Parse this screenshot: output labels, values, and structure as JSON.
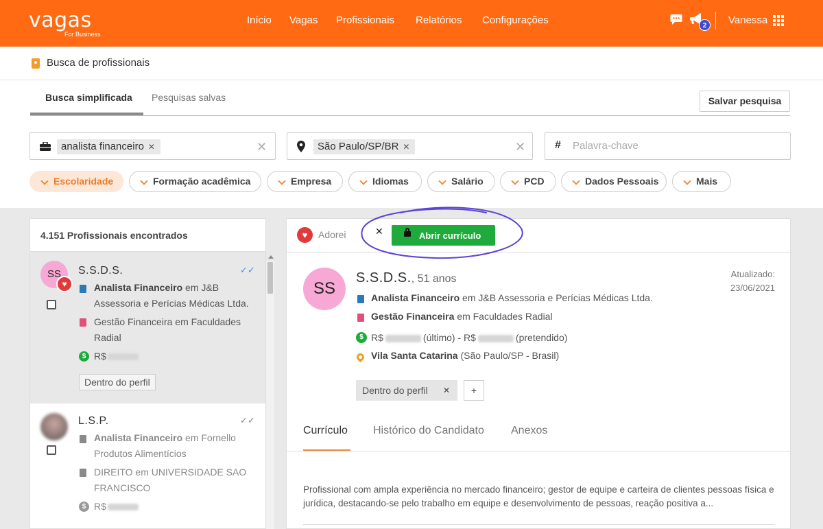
{
  "header": {
    "logo": "vagas",
    "logo_sub": "For Business",
    "nav": [
      "Início",
      "Vagas",
      "Profissionais",
      "Relatórios",
      "Configurações"
    ],
    "notification_count": "2",
    "user_name": "Vanessa"
  },
  "page": {
    "title": "Busca de profissionais"
  },
  "tabs": {
    "simple": "Busca simplificada",
    "saved": "Pesquisas salvas",
    "save_button": "Salvar pesquisa"
  },
  "search": {
    "role_chip": "analista financeiro",
    "location_chip": "São Paulo/SP/BR",
    "keyword_placeholder": "Palavra-chave"
  },
  "filters": [
    "Escolaridade",
    "Formação acadêmica",
    "Empresa",
    "Idiomas",
    "Salário",
    "PCD",
    "Dados Pessoais",
    "Mais"
  ],
  "results": {
    "count_label": "4.151 Profissionais encontrados",
    "cards": [
      {
        "initials": "SS",
        "name": "S.S.D.S.",
        "job_title": "Analista Financeiro",
        "job_rest": " em J&B Assessoria e Perícias Médicas Ltda.",
        "education": "Gestão Financeira em Faculdades Radial",
        "salary_prefix": "R$",
        "tag": "Dentro do perfil"
      },
      {
        "name": "L.S.P.",
        "job_title": "Analista Financeiro",
        "job_rest": " em Fornello Produtos Alimentícios",
        "education": "DIREITO em UNIVERSIDADE SAO FRANCISCO",
        "salary_prefix": "R$"
      }
    ]
  },
  "detail": {
    "favorite_label": "Adorei",
    "open_cv_label": "Abrir currículo",
    "initials": "SS",
    "name": "S.S.D.S.",
    "age": ", 51 anos",
    "updated_label": "Atualizado:",
    "updated_date": "23/06/2021",
    "job_title": "Analista Financeiro",
    "job_rest": " em J&B Assessoria e Perícias Médicas Ltda.",
    "education_title": "Gestão Financeira",
    "education_rest": " em Faculdades Radial",
    "salary_prefix": "R$",
    "salary_last": "(último) - R$",
    "salary_expected": "(pretendido)",
    "location_title": "Vila Santa Catarina",
    "location_rest": " (São Paulo/SP - Brasil)",
    "tag": "Dentro do perfil",
    "add_tag": "+",
    "tabs": [
      "Currículo",
      "Histórico do Candidato",
      "Anexos"
    ],
    "summary": "Profissional com ampla experiência no mercado financeiro; gestor de equipe e carteira de clientes pessoas física e jurídica, destacando-se pelo trabalho em equipe e desenvolvimento de pessoas, reação positiva a..."
  },
  "colors": {
    "brand_orange": "#ff6a13",
    "accent_orange": "#f08a3c",
    "open_cv_green": "#1eab3c",
    "heart_red": "#e23a3a",
    "avatar_pink": "#f7a8d4",
    "annotation_purple": "#5b44d6"
  }
}
